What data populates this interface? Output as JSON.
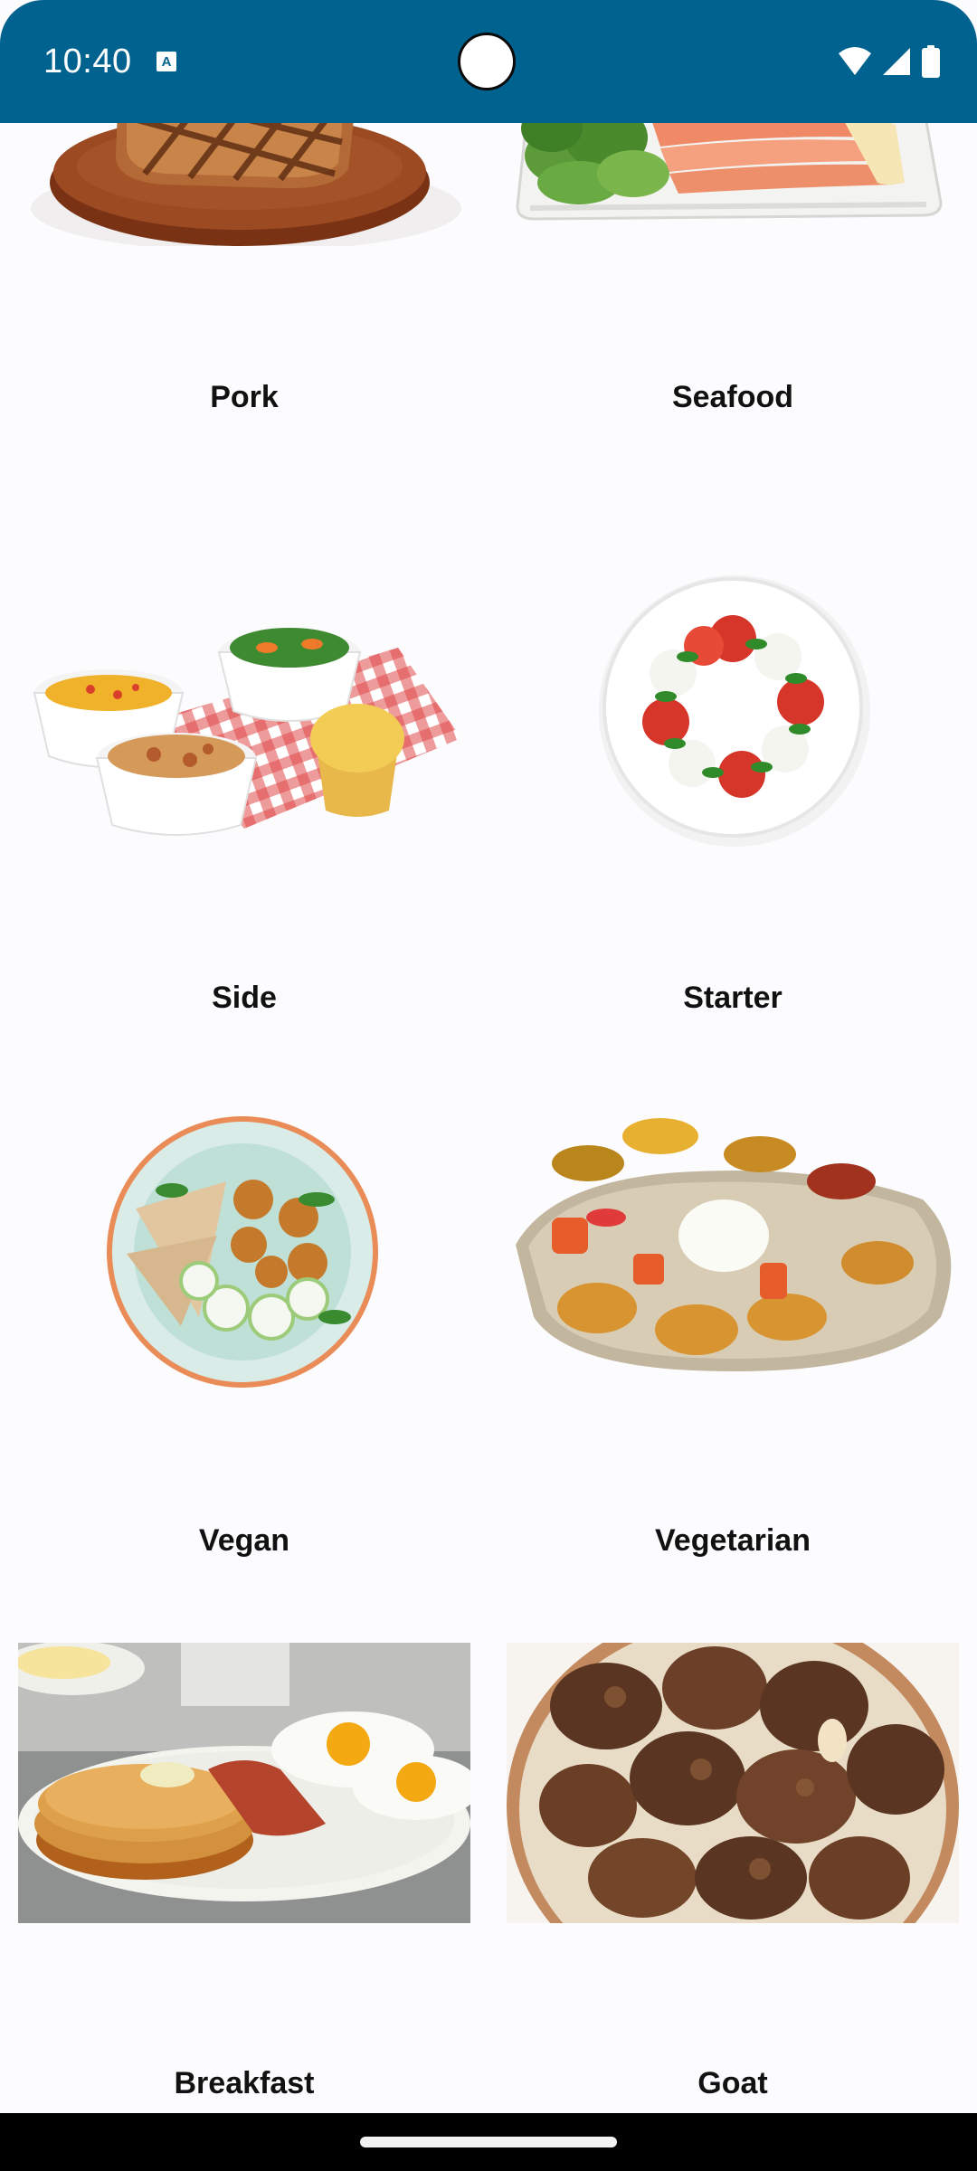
{
  "status_bar": {
    "time": "10:40",
    "colors": {
      "background": "#00628f",
      "foreground": "#ffffff"
    },
    "icons": [
      "accessibility-notification-icon",
      "wifi-icon",
      "cellular-signal-icon",
      "battery-icon"
    ]
  },
  "categories": [
    {
      "label": "Pork",
      "icon": "pork-image"
    },
    {
      "label": "Seafood",
      "icon": "seafood-image"
    },
    {
      "label": "Side",
      "icon": "side-image"
    },
    {
      "label": "Starter",
      "icon": "starter-image"
    },
    {
      "label": "Vegan",
      "icon": "vegan-image"
    },
    {
      "label": "Vegetarian",
      "icon": "vegetarian-image"
    },
    {
      "label": "Breakfast",
      "icon": "breakfast-image"
    },
    {
      "label": "Goat",
      "icon": "goat-image"
    }
  ],
  "theme": {
    "page_background": "#fcfbfe",
    "label_color": "#111111"
  }
}
